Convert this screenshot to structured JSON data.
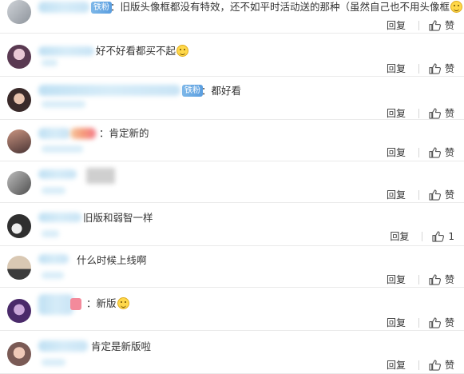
{
  "labels": {
    "reply": "回复",
    "like": "赞"
  },
  "comments": [
    {
      "badge": "铁粉",
      "text": "：旧版头像框都没有特效，还不如平时活动送的那种（虽然自己也不用头像框"
    },
    {
      "badge": "",
      "text": "好不好看都买不起"
    },
    {
      "badge": "铁粉",
      "text": "：都好看"
    },
    {
      "badge": "",
      "text": "：肯定新的"
    },
    {
      "badge": "",
      "text": ""
    },
    {
      "badge": "",
      "text": "旧版和弱智一样"
    },
    {
      "badge": "",
      "text": "什么时候上线啊"
    },
    {
      "badge": "",
      "text": "：新版"
    },
    {
      "badge": "",
      "text": "肯定是新版啦"
    }
  ],
  "row9_like_count": "1"
}
